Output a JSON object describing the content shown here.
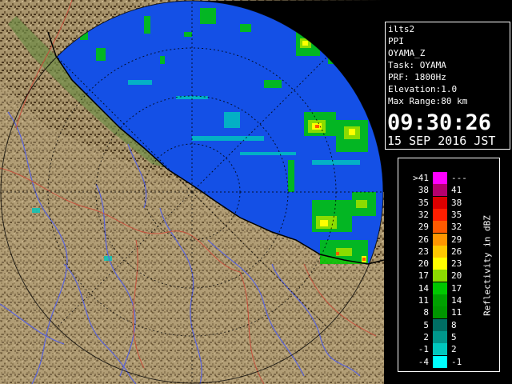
{
  "info": {
    "host": "ilts2",
    "mode": "PPI",
    "product": "OYAMA_Z",
    "task": "Task: OYAMA",
    "prf": "PRF: 1800Hz",
    "elevation": "Elevation:1.0",
    "max_range": "Max Range:80 km",
    "time": "09:30:26",
    "date": "15 SEP 2016 JST"
  },
  "legend": {
    "caption": "Reflectivity in dBZ",
    "rows": [
      {
        "low": ">41",
        "high": "---",
        "color": "#ff00ff"
      },
      {
        "low": "38",
        "high": "41",
        "color": "#b4006e"
      },
      {
        "low": "35",
        "high": "38",
        "color": "#dc0000"
      },
      {
        "low": "32",
        "high": "35",
        "color": "#ff1e00"
      },
      {
        "low": "29",
        "high": "32",
        "color": "#ff5a00"
      },
      {
        "low": "26",
        "high": "29",
        "color": "#ff9600"
      },
      {
        "low": "23",
        "high": "26",
        "color": "#ffc800"
      },
      {
        "low": "20",
        "high": "23",
        "color": "#ffff00"
      },
      {
        "low": "17",
        "high": "20",
        "color": "#8cdc00"
      },
      {
        "low": "14",
        "high": "17",
        "color": "#00c800"
      },
      {
        "low": "11",
        "high": "14",
        "color": "#00a000"
      },
      {
        "low": "8",
        "high": "11",
        "color": "#009600"
      },
      {
        "low": "5",
        "high": "8",
        "color": "#006e64"
      },
      {
        "low": "2",
        "high": "5",
        "color": "#00968c"
      },
      {
        "low": "-1",
        "high": "2",
        "color": "#00c8be"
      },
      {
        "low": "-4",
        "high": "-1",
        "color": "#00ffff"
      }
    ]
  },
  "colors": {
    "sea": "#1450e6",
    "land_light": "#b4a078",
    "land_dark": "#5a4628",
    "river": "#5a64dc",
    "boundary": "#c8503c"
  }
}
